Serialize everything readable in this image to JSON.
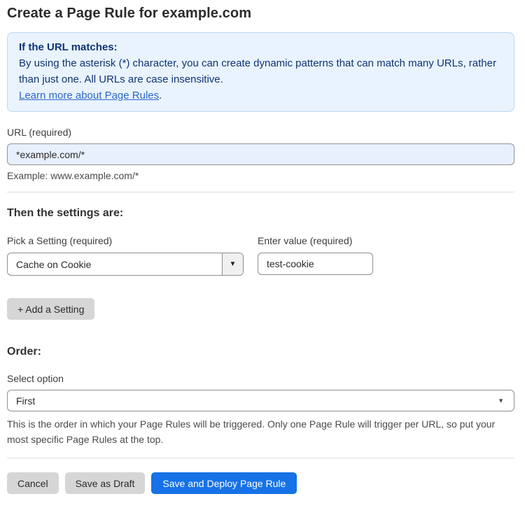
{
  "page": {
    "title": "Create a Page Rule for example.com"
  },
  "info_box": {
    "heading": "If the URL matches:",
    "body": "By using the asterisk (*) character, you can create dynamic patterns that can match many URLs, rather than just one. All URLs are case insensitive.",
    "link_label": "Learn more about Page Rules",
    "link_suffix": "."
  },
  "url_field": {
    "label": "URL (required)",
    "value": "*example.com/*",
    "hint": "Example: www.example.com/*"
  },
  "settings_section": {
    "heading": "Then the settings are:",
    "setting_label": "Pick a Setting (required)",
    "setting_value": "Cache on Cookie",
    "value_label": "Enter value (required)",
    "value_value": "test-cookie",
    "add_button_label": "+ Add a Setting"
  },
  "order_section": {
    "heading": "Order:",
    "select_label": "Select option",
    "select_value": "First",
    "description": "This is the order in which your Page Rules will be triggered. Only one Page Rule will trigger per URL, so put your most specific Page Rules at the top."
  },
  "footer": {
    "cancel_label": "Cancel",
    "save_draft_label": "Save as Draft",
    "save_deploy_label": "Save and Deploy Page Rule"
  },
  "icons": {
    "dropdown_arrow": "▼"
  },
  "colors": {
    "accent_blue": "#1672e6",
    "info_bg": "#e9f3fd",
    "info_border": "#bdd7f2",
    "info_text": "#0d3575",
    "link_blue": "#2c67c8",
    "input_focus_bg": "#e8f0fe",
    "button_gray": "#d6d6d6"
  }
}
